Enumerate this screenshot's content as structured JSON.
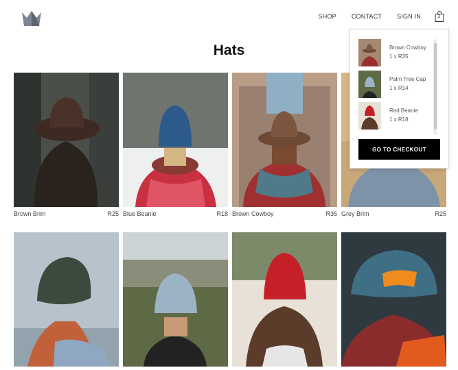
{
  "header": {
    "nav": [
      "SHOP",
      "CONTACT",
      "SIGN IN"
    ],
    "cart_count": "3"
  },
  "page_title": "Hats",
  "products": [
    {
      "name": "Brown Brim",
      "price": "R25"
    },
    {
      "name": "Blue Beanie",
      "price": "R18"
    },
    {
      "name": "Brown Cowboy",
      "price": "R35"
    },
    {
      "name": "Grey Brim",
      "price": "R25"
    },
    {
      "name": "",
      "price": ""
    },
    {
      "name": "",
      "price": ""
    },
    {
      "name": "",
      "price": ""
    },
    {
      "name": "",
      "price": ""
    }
  ],
  "cart": {
    "items": [
      {
        "name": "Brown Cowboy",
        "qty": "1 x R35"
      },
      {
        "name": "Palm Tree Cap",
        "qty": "1 x R14"
      },
      {
        "name": "Red Beanie",
        "qty": "1 x R18"
      }
    ],
    "checkout_label": "GO TO CHECKOUT"
  }
}
